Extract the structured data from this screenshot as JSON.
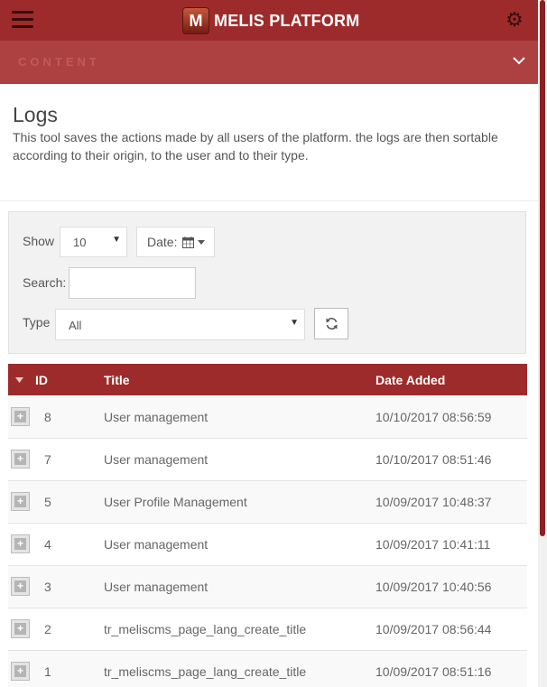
{
  "header": {
    "brand_logo_letter": "M",
    "brand_title": "MELIS PLATFORM",
    "section_label": "CONTENT",
    "colors": {
      "primary": "#9e2b2b",
      "subbar": "#ad4040"
    }
  },
  "page": {
    "title": "Logs",
    "description": "This tool saves the actions made by all users of the platform. the logs are then sortable according to their origin, to the user and to their type."
  },
  "filters": {
    "show_label": "Show",
    "show_value": "10",
    "date_label": "Date:",
    "search_label": "Search:",
    "search_value": "",
    "type_label": "Type",
    "type_value": "All"
  },
  "table": {
    "columns": [
      "ID",
      "Title",
      "Date Added"
    ],
    "rows": [
      {
        "id": "8",
        "title": "User management",
        "date": "10/10/2017 08:56:59"
      },
      {
        "id": "7",
        "title": "User management",
        "date": "10/10/2017 08:51:46"
      },
      {
        "id": "5",
        "title": "User Profile Management",
        "date": "10/09/2017 10:48:37"
      },
      {
        "id": "4",
        "title": "User management",
        "date": "10/09/2017 10:41:11"
      },
      {
        "id": "3",
        "title": "User management",
        "date": "10/09/2017 10:40:56"
      },
      {
        "id": "2",
        "title": "tr_meliscms_page_lang_create_title",
        "date": "10/09/2017 08:56:44"
      },
      {
        "id": "1",
        "title": "tr_meliscms_page_lang_create_title",
        "date": "10/09/2017 08:51:16"
      }
    ]
  }
}
